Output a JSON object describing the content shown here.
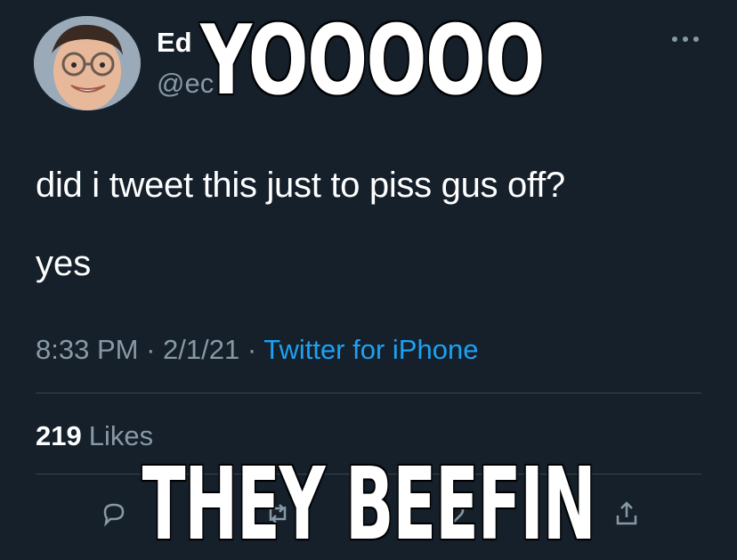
{
  "tweet": {
    "display_name": "Ed",
    "handle": "@ec",
    "text": "did i tweet this just to piss gus off?",
    "text_second": "yes",
    "time": "8:33 PM",
    "date": "2/1/21",
    "source": "Twitter for iPhone",
    "sep": " · ",
    "likes_count": "219",
    "likes_label": "Likes"
  },
  "meme": {
    "top_caption": "YOOOOO",
    "bottom_caption": "THEY BEEFIN"
  },
  "icons": {
    "more": "more-horizontal-icon",
    "reply": "reply-icon",
    "retweet": "retweet-icon",
    "like": "heart-icon",
    "share": "share-icon"
  },
  "colors": {
    "background": "#15202b",
    "secondary_text": "#8899a6",
    "link": "#1da1f2",
    "divider": "#38444d"
  }
}
